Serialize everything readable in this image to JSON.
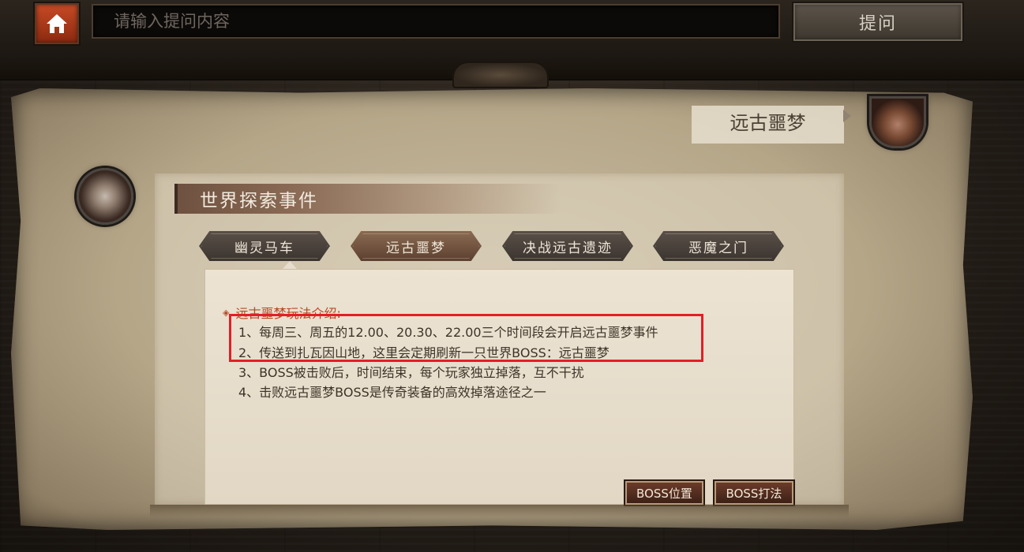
{
  "topbar": {
    "search_placeholder": "请输入提问内容",
    "ask_label": "提问"
  },
  "header": {
    "title": "远古噩梦"
  },
  "section": {
    "title": "世界探索事件"
  },
  "tabs": [
    {
      "label": "幽灵马车",
      "active": false
    },
    {
      "label": "远古噩梦",
      "active": true
    },
    {
      "label": "决战远古遗迹",
      "active": false
    },
    {
      "label": "恶魔之门",
      "active": false
    }
  ],
  "content": {
    "intro_title": "远古噩梦玩法介绍:",
    "lines": [
      "1、每周三、周五的12.00、20.30、22.00三个时间段会开启远古噩梦事件",
      "2、传送到扎瓦因山地，这里会定期刷新一只世界BOSS：远古噩梦",
      "3、BOSS被击败后，时间结束，每个玩家独立掉落，互不干扰",
      "4、击败远古噩梦BOSS是传奇装备的高效掉落途径之一"
    ]
  },
  "buttons": {
    "boss_location": "BOSS位置",
    "boss_strategy": "BOSS打法"
  },
  "colors": {
    "accent_orange": "#c64a25",
    "intro_red": "#b44a24",
    "highlight_red": "#e41e25"
  }
}
